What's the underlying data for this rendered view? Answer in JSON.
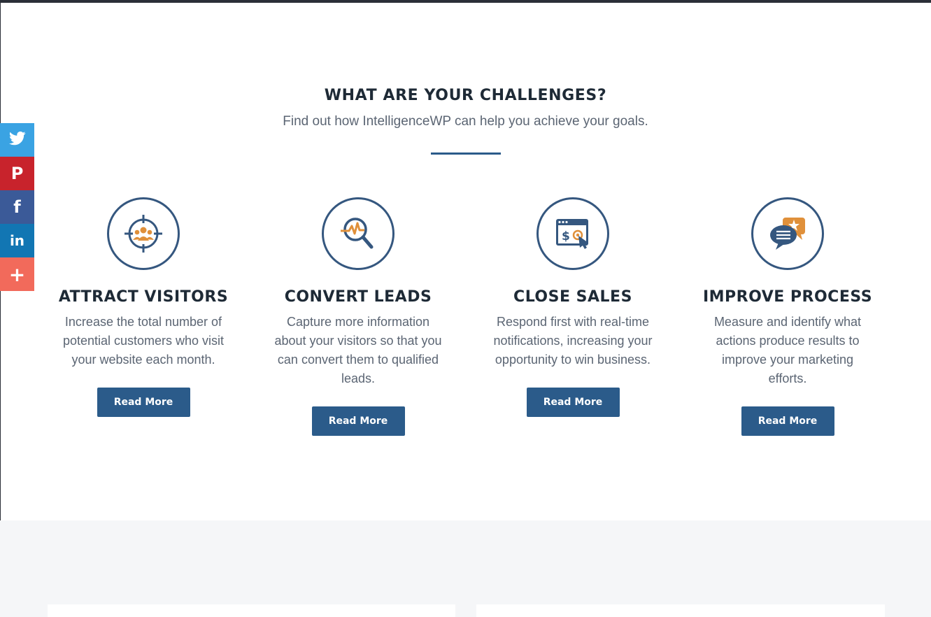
{
  "section": {
    "heading": "WHAT ARE YOUR CHALLENGES?",
    "subheading": "Find out how IntelligenceWP can help you achieve your goals."
  },
  "challenges": [
    {
      "title": "ATTRACT VISITORS",
      "description": "Increase the total number of potential customers who visit your website each month.",
      "button": "Read More",
      "icon": "target-people-icon"
    },
    {
      "title": "CONVERT LEADS",
      "description": "Capture more information about your visitors so that you can convert them to qualified leads.",
      "button": "Read More",
      "icon": "magnifier-chart-icon"
    },
    {
      "title": "CLOSE SALES",
      "description": "Respond first with real-time notifications, increasing your opportunity to win business.",
      "button": "Read More",
      "icon": "browser-dollar-click-icon"
    },
    {
      "title": "IMPROVE PROCESS",
      "description": "Measure and identify what actions produce results to improve your marketing efforts.",
      "button": "Read More",
      "icon": "chat-bubbles-star-icon"
    }
  ],
  "social": {
    "twitter": "twitter-icon",
    "pinterest": "pinterest-icon",
    "facebook": "facebook-icon",
    "linkedin": "linkedin-icon",
    "more": "more-icon",
    "pinterest_glyph": "P",
    "facebook_glyph": "f",
    "linkedin_glyph": "in",
    "more_glyph": "+"
  },
  "colors": {
    "accent": "#2b5b8a",
    "icon_stroke": "#35577f",
    "icon_orange": "#e0903a",
    "heading": "#1e2a36",
    "body_text": "#5b6573"
  }
}
